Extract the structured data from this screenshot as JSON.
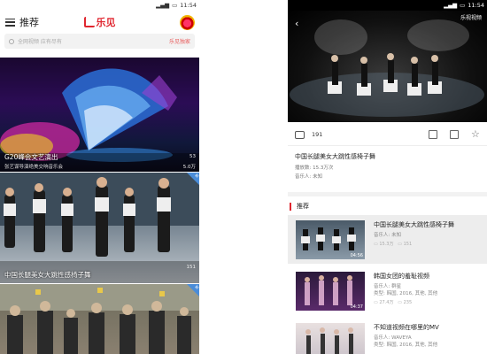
{
  "left": {
    "status": {
      "time": "11:54"
    },
    "header": {
      "title": "推荐",
      "logo": "乐见"
    },
    "search": {
      "placeholder": "全网视频 应有尽有",
      "hot": "乐见独家"
    },
    "cards": [
      {
        "title": "G20峰会文艺演出",
        "subtitle": "张艺谋导演绝美交响音乐会",
        "count": "53",
        "plays": "5.0万",
        "badge": ""
      },
      {
        "title": "中国长腿美女大跳性感椅子舞",
        "subtitle": "",
        "count": "151",
        "plays": "",
        "badge": "新"
      },
      {
        "title": "",
        "subtitle": "",
        "count": "",
        "plays": "",
        "badge": "新"
      }
    ]
  },
  "right": {
    "status": {
      "time": "11:54"
    },
    "player": {
      "label": "乐视视频"
    },
    "actions": {
      "comment_count": "191"
    },
    "info": {
      "title": "中国长腿美女大跳性感椅子舞",
      "plays": "播放数: 15.3万次",
      "musician": "音乐人: 未知"
    },
    "recommend": {
      "heading": "推荐"
    },
    "items": [
      {
        "title": "中国长腿美女大跳性感椅子舞",
        "line1": "音乐人: 未知",
        "line2": "",
        "duration": "04:56",
        "views": "15.3万",
        "comments": "151"
      },
      {
        "title": "韩国女团的羞耻视频",
        "line1": "音乐人: 群星",
        "line2": "类型: 韩国, 2016, 其他, 其他",
        "duration": "04:37",
        "views": "27.4万",
        "comments": "235"
      },
      {
        "title": "不知道视频在哪里的MV",
        "line1": "音乐人: WAVEYA",
        "line2": "类型: 韩国, 2016, 其他, 其他",
        "duration": "",
        "views": "",
        "comments": ""
      }
    ]
  }
}
